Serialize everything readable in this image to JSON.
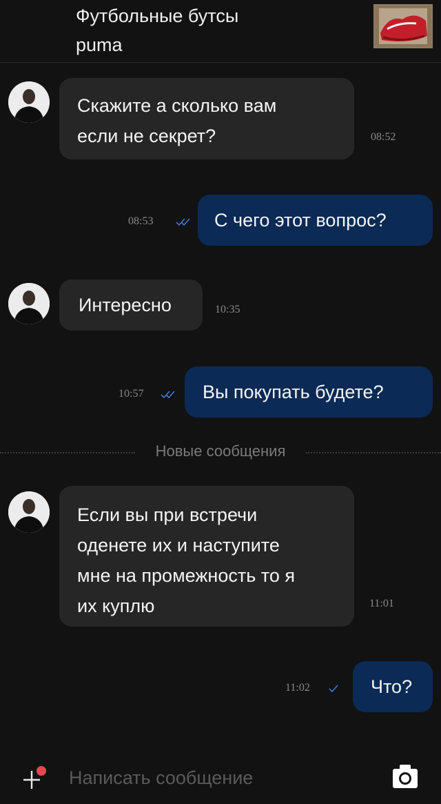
{
  "header": {
    "title": "Футбольные бутсы\npuma"
  },
  "messages": [
    {
      "text": "Скажите а сколько вам\nесли не секрет?",
      "time": "08:52"
    },
    {
      "text": "С чего этот вопрос?",
      "time": "08:53"
    },
    {
      "text": "Интересно",
      "time": "10:35"
    },
    {
      "text": "Вы покупать будете?",
      "time": "10:57"
    },
    {
      "text": "Если вы при встречи\nоденете  их и наступите\nмне на промежность то я\nих куплю",
      "time": "11:01"
    },
    {
      "text": "Что?",
      "time": "11:02"
    }
  ],
  "divider": {
    "label": "Новые сообщения"
  },
  "input": {
    "placeholder": "Написать сообщение"
  },
  "colors": {
    "background": "#121212",
    "incoming_bubble": "#262626",
    "outgoing_bubble": "#0b2a55",
    "read_check": "#3d7bd9",
    "notification_dot": "#e2494f"
  },
  "icons": {
    "plus": "plus-icon",
    "camera": "camera-icon",
    "read_receipt": "double-check-icon",
    "sent_receipt": "check-icon"
  }
}
